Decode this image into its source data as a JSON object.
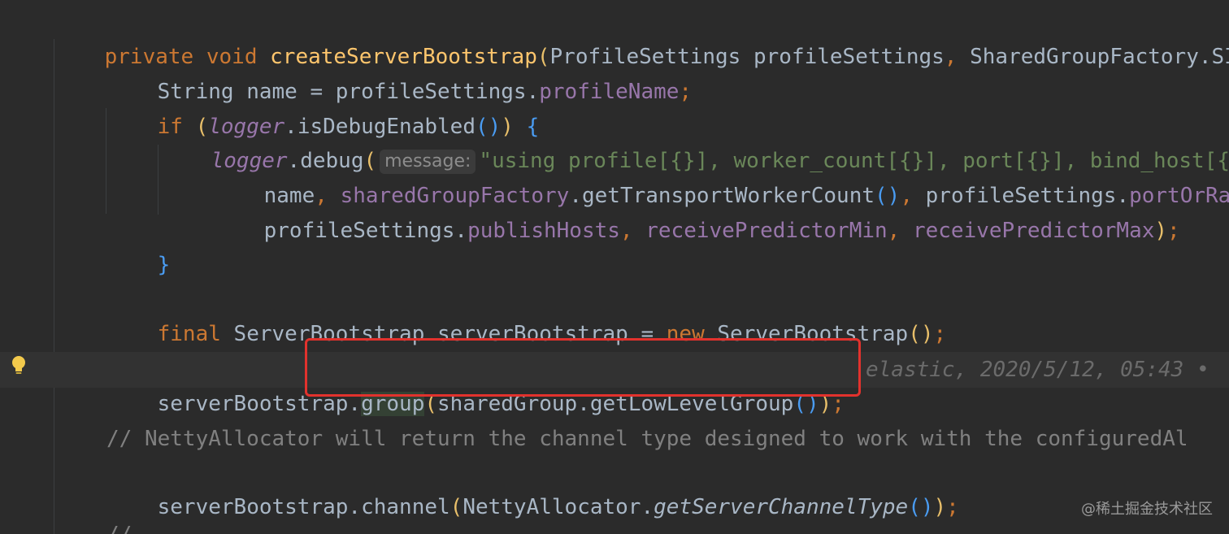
{
  "editor": {
    "lines": {
      "l1": {
        "kw1": "private",
        "kw2": "void",
        "method": "createServerBootstrap",
        "open": "(",
        "t1": "ProfileSettings profileSettings",
        "comma": ",",
        "t2": " SharedGroupFactory.SI"
      },
      "l2": {
        "t1": "String name = profileSettings.",
        "field": "profileName",
        "semi": ";"
      },
      "l3": {
        "kw": "if",
        "open": "(",
        "field": "logger",
        "t1": ".isDebugEnabled",
        "call": "()",
        "close": ")",
        "brace": "{"
      },
      "l4": {
        "field": "logger",
        "t1": ".debug",
        "open": "(",
        "hint": "message:",
        "str": "\"using profile[{}], worker_count[{}], port[{}], bind_host[{"
      },
      "l5": {
        "t1": "name",
        "c1": ",",
        "field1": "sharedGroupFactory",
        "t2": ".getTransportWorkerCount",
        "call": "()",
        "c2": ",",
        "t3": " profileSettings.",
        "field2": "portOrRan"
      },
      "l6": {
        "t1": "profileSettings.",
        "field1": "publishHosts",
        "c1": ",",
        "field2": "receivePredictorMin",
        "c2": ",",
        "field3": "receivePredictorMax",
        "close": ")",
        "semi": ";"
      },
      "l7": {
        "brace": "}"
      },
      "l8": {
        "kw1": "final",
        "t1": " ServerBootstrap serverBootstrap = ",
        "kw2": "new",
        "t2": " ServerBootstrap",
        "call": "()",
        "semi": ";"
      },
      "l9": {
        "t1": "serverBootstrap.",
        "group": "group",
        "open": "(",
        "t2": "sharedGroup.getLowLevelGroup",
        "call": "()",
        "close": ")",
        "semi": ";",
        "blame": "elastic, 2020/5/12, 05:43 •"
      },
      "l10": {
        "comment": "// NettyAllocator will return the channel type designed to work with the configuredAl"
      },
      "l11": {
        "t1": "serverBootstrap.channel",
        "open": "(",
        "t2": "NettyAllocator.",
        "italic": "getServerChannelType",
        "call": "()",
        "close": ")",
        "semi": ";"
      },
      "l12": {
        "comment": "//"
      }
    }
  },
  "watermark": "@稀土掘金技术社区",
  "icons": {
    "gutter": "lightbulb-icon"
  },
  "colors": {
    "highlight_box": "#e2322d",
    "background": "#2b2b2b"
  }
}
